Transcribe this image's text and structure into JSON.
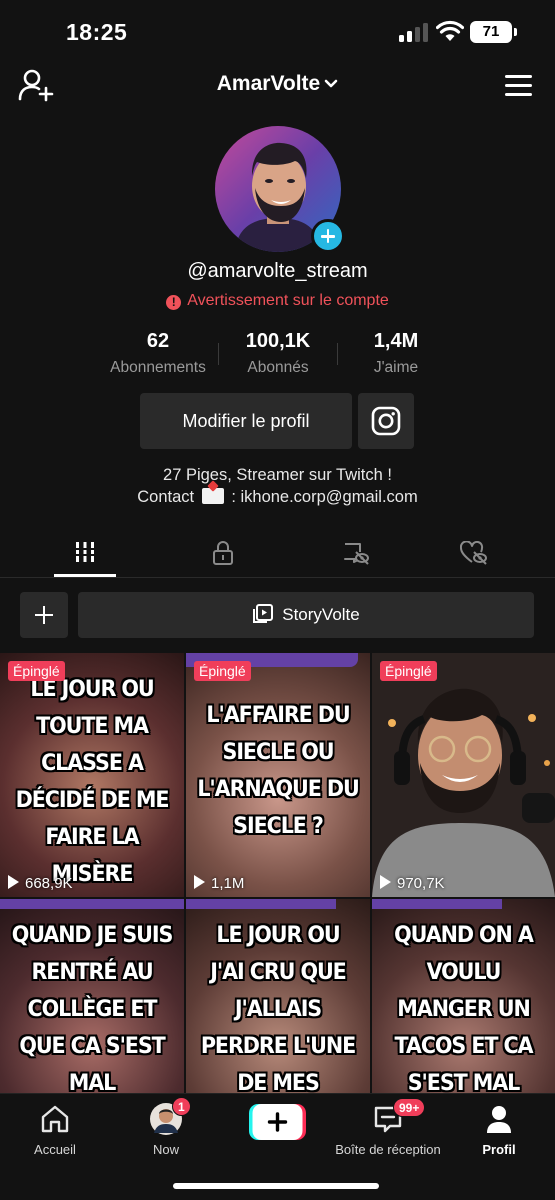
{
  "status_bar": {
    "time": "18:25",
    "battery": "71"
  },
  "header": {
    "username": "AmarVolte"
  },
  "profile": {
    "handle": "@amarvolte_stream",
    "warning": "Avertissement sur le compte",
    "stats": [
      {
        "value": "62",
        "label": "Abonnements"
      },
      {
        "value": "100,1K",
        "label": "Abonnés"
      },
      {
        "value": "1,4M",
        "label": "J'aime"
      }
    ],
    "edit_button": "Modifier le profil",
    "bio_line1": "27 Piges, Streamer sur Twitch !",
    "bio_contact_prefix": "Contact",
    "bio_contact_email": ": ikhone.corp@gmail.com"
  },
  "tabs": [
    "videos-grid-icon",
    "private-lock-icon",
    "reposts-hidden-icon",
    "liked-hidden-icon"
  ],
  "playlist": {
    "label": "StoryVolte"
  },
  "videos": [
    {
      "pinned": "Épinglé",
      "caption": "LE JOUR OU TOUTE MA CLASSE A DÉCIDÉ DE ME FAIRE LA MISÈRE",
      "views": "668,9K",
      "bg": "#5b2f2f"
    },
    {
      "pinned": "Épinglé",
      "caption": "L'AFFAIRE DU SIECLE OU L'ARNAQUE DU SIECLE ?",
      "views": "1,1M",
      "bg": "#6a4a40"
    },
    {
      "pinned": "Épinglé",
      "caption": "",
      "views": "970,7K",
      "bg": "#3a302c"
    },
    {
      "pinned": "",
      "caption": "QUAND JE SUIS RENTRÉ AU COLLÈGE ET QUE CA S'EST MAL",
      "views": "",
      "bg": "#4d2b2e"
    },
    {
      "pinned": "",
      "caption": "LE JOUR OU J'AI CRU QUE J'ALLAIS PERDRE L'UNE DE MES",
      "views": "",
      "bg": "#5d3c36"
    },
    {
      "pinned": "",
      "caption": "QUAND ON A VOULU MANGER UN TACOS ET CA S'EST MAL",
      "views": "",
      "bg": "#553532"
    }
  ],
  "bottom_nav": {
    "home": "Accueil",
    "now": "Now",
    "now_badge": "1",
    "inbox": "Boîte de réception",
    "inbox_badge": "99+",
    "profile": "Profil"
  },
  "colors": {
    "accent_red": "#f03e5a",
    "warning_red": "#f0525a",
    "plus_blue": "#26b8e3",
    "background": "#121212"
  }
}
